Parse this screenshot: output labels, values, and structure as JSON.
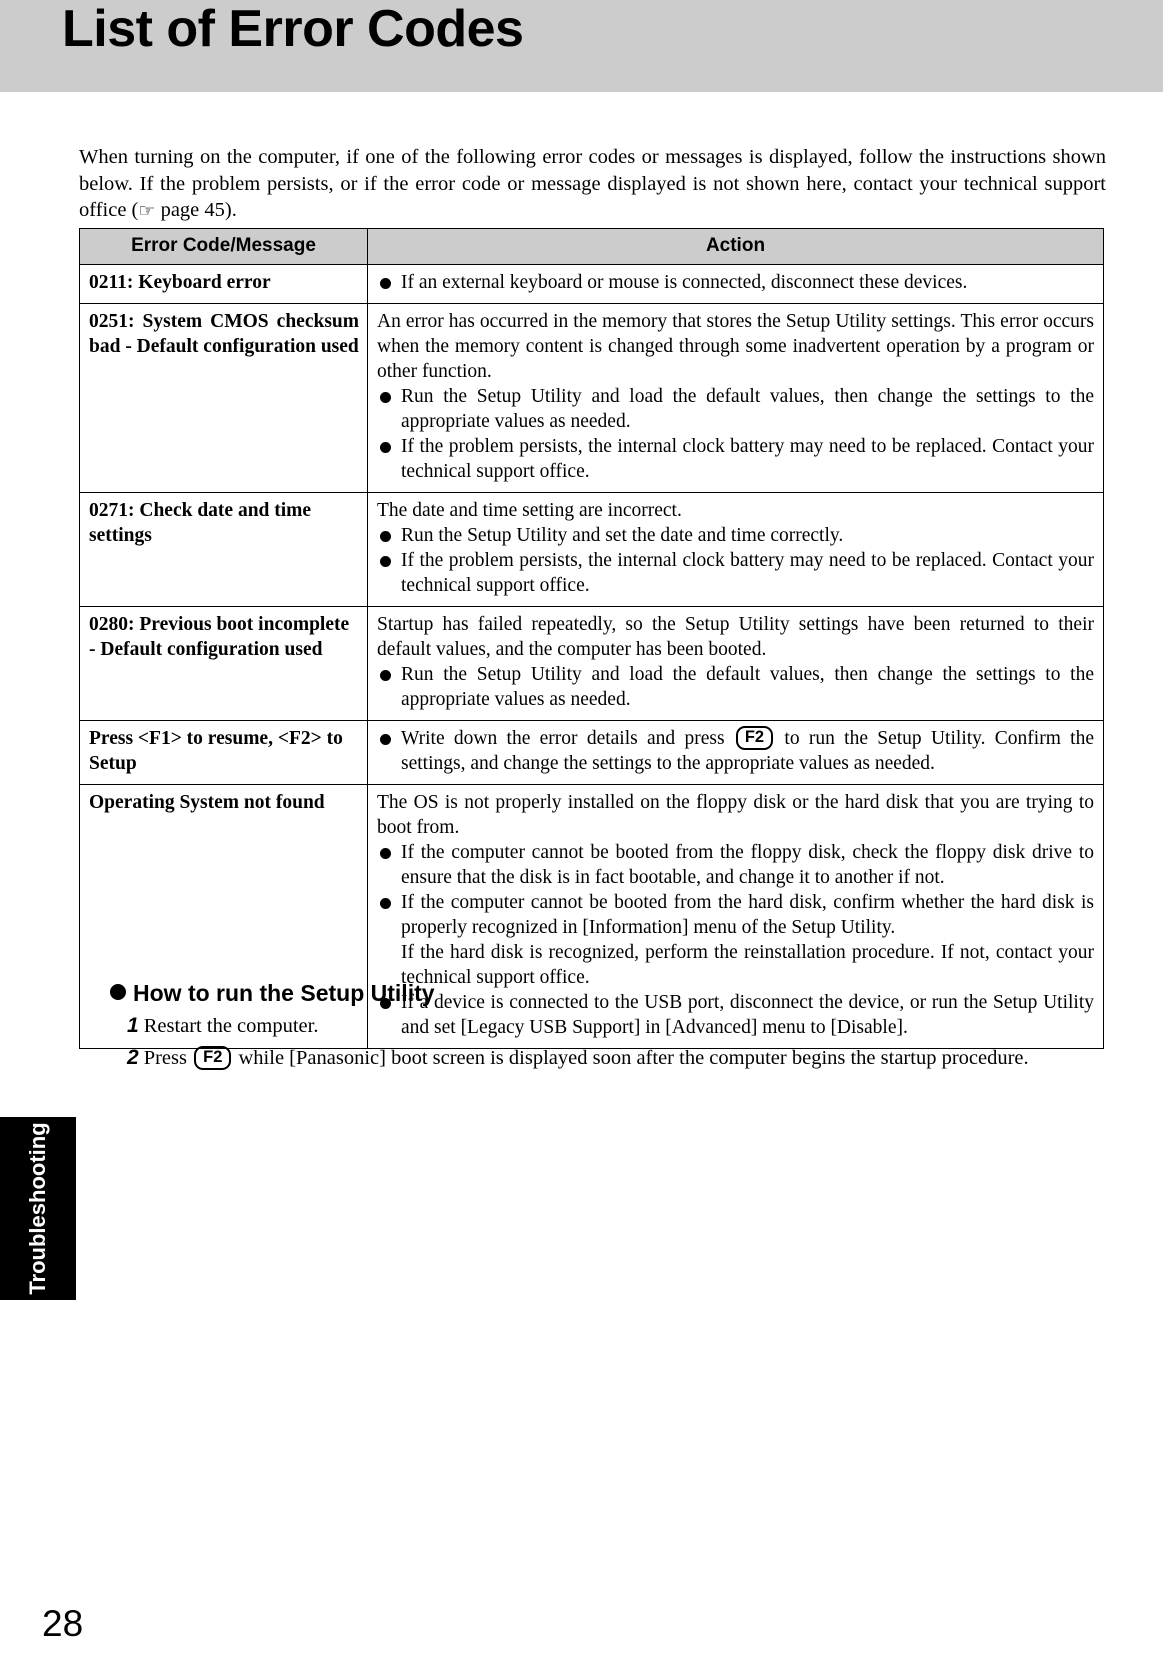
{
  "page": {
    "title": "List of Error Codes",
    "number": "28",
    "side_tab": "Troubleshooting"
  },
  "intro": {
    "part1": "When turning on the computer, if one of the following error codes or messages is displayed, follow the instructions shown below. If the problem persists, or if the error code or message displayed is not shown here, contact your technical support office (",
    "hand_icon": "☞",
    "part2": " page 45)."
  },
  "table": {
    "headers": {
      "code": "Error Code/Message",
      "action": "Action"
    },
    "rows": [
      {
        "code": "0211: Keyboard error",
        "intro": "",
        "bullets": [
          {
            "text": "If an external keyboard or mouse is connected, disconnect these devices."
          }
        ]
      },
      {
        "code": "0251: System CMOS checksum bad - Default configuration used",
        "intro": "An error has occurred in the memory that stores the Setup Utility settings.  This error occurs when the memory content is changed through some inadvertent operation by a program or other function.",
        "bullets": [
          {
            "text": "Run the Setup Utility and load the default values, then change the settings to the appropriate values as needed."
          },
          {
            "text": "If the problem persists, the internal clock battery may need to be replaced. Contact your technical support office."
          }
        ]
      },
      {
        "code": "0271: Check date and time settings",
        "intro": "The date and time setting are incorrect.",
        "bullets": [
          {
            "text": "Run the Setup Utility and set the date and time correctly."
          },
          {
            "text": "If the problem persists, the internal clock battery may need to be replaced. Contact your technical support office."
          }
        ]
      },
      {
        "code": "0280: Previous boot incomplete - Default configuration used",
        "intro": "Startup has failed repeatedly, so the Setup Utility settings have been returned to their default values, and the computer has been booted.",
        "bullets": [
          {
            "text": "Run the Setup Utility and load the default values, then change the settings to the appropriate values as needed."
          }
        ]
      },
      {
        "code": "Press <F1> to resume, <F2> to Setup",
        "intro": "",
        "bullets": [
          {
            "before": "Write down the error details and press",
            "key": "F2",
            "after": "to run the Setup Utility. Confirm the settings, and change the settings to the appropriate values as needed."
          }
        ]
      },
      {
        "code": "Operating System not found",
        "intro": "The OS is not properly installed on the floppy disk or the hard disk that you are trying to boot from.",
        "bullets": [
          {
            "text": "If the computer cannot be booted from the floppy disk, check the floppy disk drive to ensure that the disk is in fact bootable, and change it to another if not."
          },
          {
            "text": "If the computer cannot be booted from the hard disk, confirm whether the hard disk is properly recognized in [Information] menu of the Setup Utility.",
            "sub": "If the hard disk is recognized, perform the reinstallation procedure. If not, contact your technical support office."
          },
          {
            "text": "If a device is connected to the USB port, disconnect the device, or run the Setup Utility and set [Legacy USB Support] in [Advanced] menu to [Disable]."
          }
        ]
      }
    ]
  },
  "setup": {
    "heading": "How to run the Setup Utility",
    "steps": [
      {
        "num": "1",
        "before": "Restart the computer.",
        "key": "",
        "after": ""
      },
      {
        "num": "2",
        "before": "Press",
        "key": "F2",
        "after": "while [Panasonic] boot screen is displayed soon after the computer begins the startup procedure."
      }
    ]
  }
}
